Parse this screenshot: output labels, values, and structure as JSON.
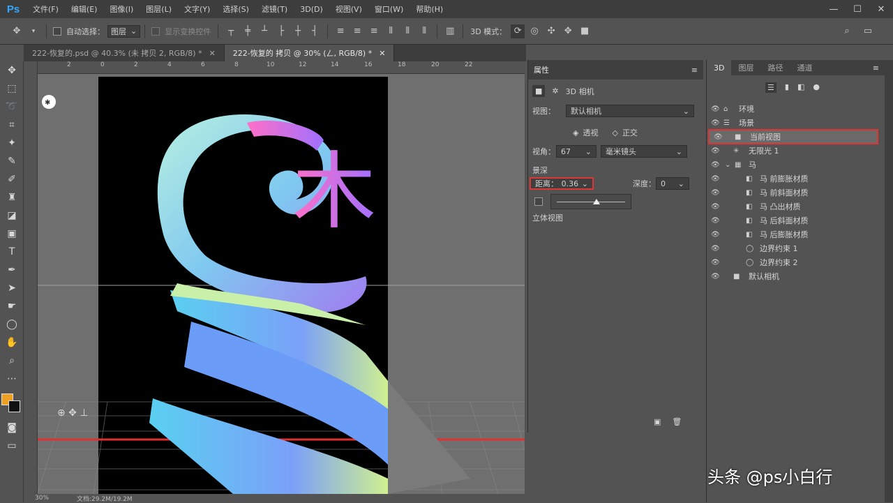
{
  "app": {
    "logo": "Ps"
  },
  "menu": [
    "文件(F)",
    "编辑(E)",
    "图像(I)",
    "图层(L)",
    "文字(Y)",
    "选择(S)",
    "滤镜(T)",
    "3D(D)",
    "视图(V)",
    "窗口(W)",
    "帮助(H)"
  ],
  "window_controls": {
    "minimize": "—",
    "maximize": "☐",
    "close": "✕"
  },
  "options_bar": {
    "auto_select_label": "自动选择：",
    "auto_select_value": "图层",
    "show_transform_label": "显示变换控件",
    "mode_3d_label": "3D 模式："
  },
  "tabs": [
    {
      "label": "222-恢复的.psd @ 40.3% (未 拷贝 2, RGB/8) *",
      "close": "✕"
    },
    {
      "label": "222-恢复的 拷贝 @ 30% (ㄥ, RGB/8) *",
      "close": "✕"
    }
  ],
  "ruler_labels": [
    "2",
    "0",
    "2",
    "4",
    "6",
    "8",
    "10",
    "12",
    "14",
    "16",
    "18",
    "20",
    "22"
  ],
  "status": {
    "zoom": "30%",
    "doc": "文档:29.2M/19.2M"
  },
  "properties": {
    "panel_title": "属性",
    "camera_label": "3D 相机",
    "view_label": "视图：",
    "view_value": "默认相机",
    "perspective_label": "透视",
    "ortho_label": "正交",
    "fov_label": "视角：",
    "fov_value": "67",
    "lens_value": "毫米镜头",
    "dof_label": "景深",
    "distance_label": "距离：",
    "distance_value": "0.36",
    "depth_label": "深度：",
    "depth_value": "0",
    "stereo_label": "立体视图"
  },
  "right_panel": {
    "tabs": [
      "3D",
      "图层",
      "路径",
      "通道"
    ],
    "items": [
      {
        "label": "环境",
        "icon": "globe-icon",
        "highlight": false
      },
      {
        "label": "场景",
        "icon": "scene-icon",
        "highlight": false
      },
      {
        "label": "当前视图",
        "icon": "camera-icon",
        "highlight": true
      },
      {
        "label": "无限光 1",
        "icon": "light-icon",
        "highlight": false
      },
      {
        "label": "马",
        "icon": "mesh-icon",
        "highlight": false
      },
      {
        "label": "马 前膨胀材质",
        "icon": "material-icon",
        "highlight": false
      },
      {
        "label": "马 前斜面材质",
        "icon": "material-icon",
        "highlight": false
      },
      {
        "label": "马 凸出材质",
        "icon": "material-icon",
        "highlight": false
      },
      {
        "label": "马 后斜面材质",
        "icon": "material-icon",
        "highlight": false
      },
      {
        "label": "马 后膨胀材质",
        "icon": "material-icon",
        "highlight": false
      },
      {
        "label": "边界约束 1",
        "icon": "constraint-icon",
        "highlight": false
      },
      {
        "label": "边界约束 2",
        "icon": "constraint-icon",
        "highlight": false
      },
      {
        "label": "默认相机",
        "icon": "camera-icon",
        "highlight": false
      }
    ]
  },
  "canvas": {
    "glyph": "木"
  },
  "watermark": "头条 @ps小白行",
  "colors": {
    "accent": "#31a8ff",
    "highlight_box": "#e03535",
    "foreground": "#f0a020",
    "background": "#111111"
  }
}
